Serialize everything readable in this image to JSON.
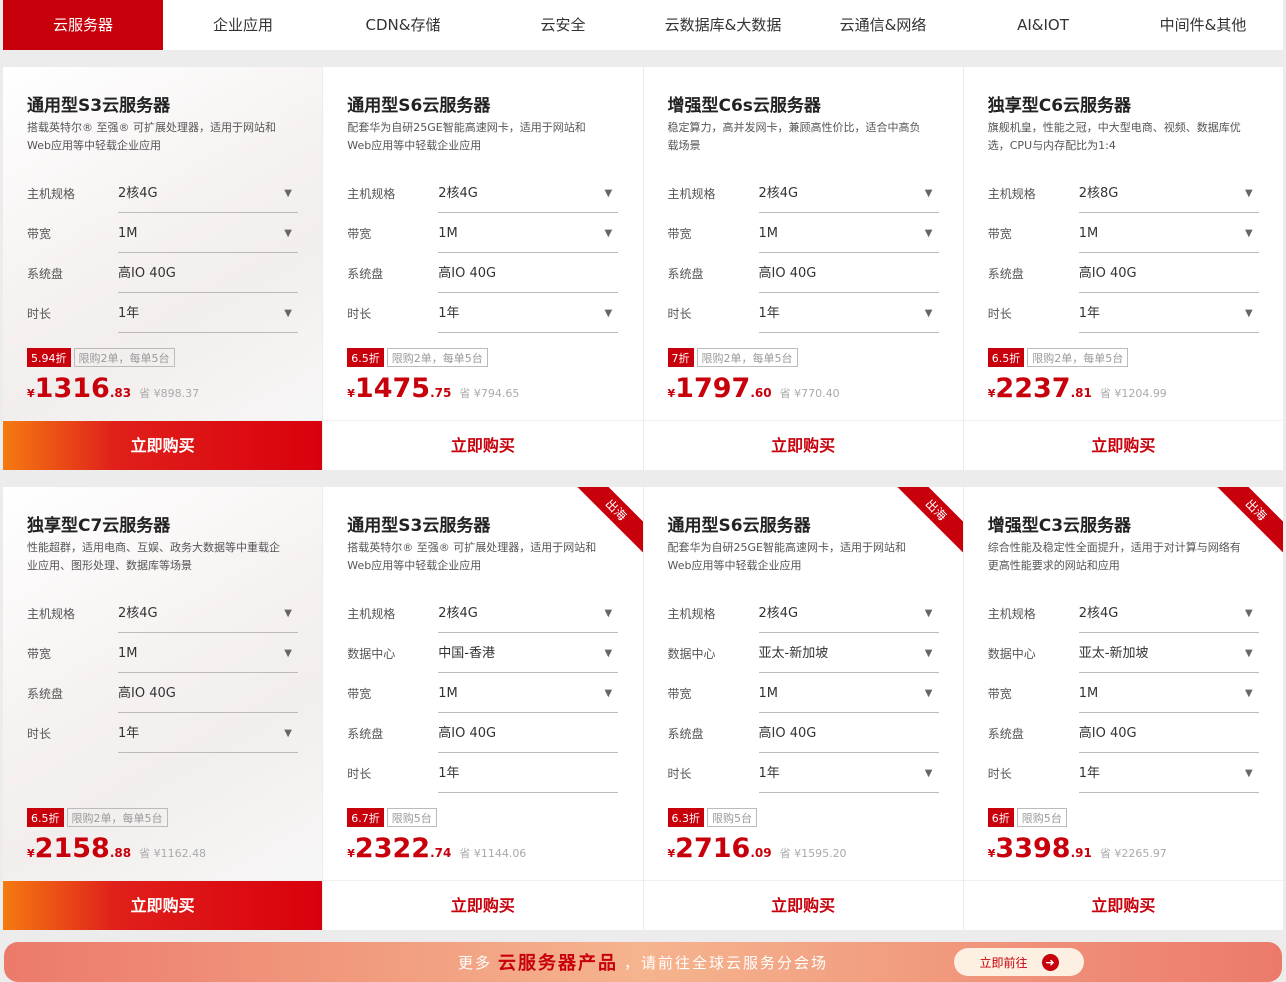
{
  "tabs": [
    "云服务器",
    "企业应用",
    "CDN&存储",
    "云安全",
    "云数据库&大数据",
    "云通信&网络",
    "AI&IOT",
    "中间件&其他"
  ],
  "buy_label": "立即购买",
  "ribbon_label": "出海",
  "rows": [
    [
      {
        "title": "通用型S3云服务器",
        "desc": "搭载英特尔® 至强® 可扩展处理器，适用于网站和Web应用等中轻载企业应用",
        "fields": [
          [
            "主机规格",
            "2核4G",
            1
          ],
          [
            "带宽",
            "1M",
            1
          ],
          [
            "系统盘",
            "高IO 40G",
            0
          ],
          [
            "时长",
            "1年",
            1
          ]
        ],
        "discount": "5.94折",
        "limit": "限购2单，每单5台",
        "price_int": "1316",
        "price_dec": ".83",
        "save": "省 ¥898.37",
        "ribbon": false
      },
      {
        "title": "通用型S6云服务器",
        "desc": "配套华为自研25GE智能高速网卡，适用于网站和Web应用等中轻载企业应用",
        "fields": [
          [
            "主机规格",
            "2核4G",
            1
          ],
          [
            "带宽",
            "1M",
            1
          ],
          [
            "系统盘",
            "高IO 40G",
            0
          ],
          [
            "时长",
            "1年",
            1
          ]
        ],
        "discount": "6.5折",
        "limit": "限购2单，每单5台",
        "price_int": "1475",
        "price_dec": ".75",
        "save": "省 ¥794.65",
        "ribbon": false
      },
      {
        "title": "增强型C6s云服务器",
        "desc": "稳定算力，高并发网卡，兼顾高性价比，适合中高负载场景",
        "fields": [
          [
            "主机规格",
            "2核4G",
            1
          ],
          [
            "带宽",
            "1M",
            1
          ],
          [
            "系统盘",
            "高IO 40G",
            0
          ],
          [
            "时长",
            "1年",
            1
          ]
        ],
        "discount": "7折",
        "limit": "限购2单，每单5台",
        "price_int": "1797",
        "price_dec": ".60",
        "save": "省 ¥770.40",
        "ribbon": false
      },
      {
        "title": "独享型C6云服务器",
        "desc": "旗舰机皇，性能之冠，中大型电商、视频、数据库优选，CPU与内存配比为1:4",
        "fields": [
          [
            "主机规格",
            "2核8G",
            1
          ],
          [
            "带宽",
            "1M",
            1
          ],
          [
            "系统盘",
            "高IO 40G",
            0
          ],
          [
            "时长",
            "1年",
            1
          ]
        ],
        "discount": "6.5折",
        "limit": "限购2单，每单5台",
        "price_int": "2237",
        "price_dec": ".81",
        "save": "省 ¥1204.99",
        "ribbon": false
      }
    ],
    [
      {
        "title": "独享型C7云服务器",
        "desc": "性能超群，适用电商、互娱、政务大数据等中重载企业应用、图形处理、数据库等场景",
        "fields": [
          [
            "主机规格",
            "2核4G",
            1
          ],
          [
            "带宽",
            "1M",
            1
          ],
          [
            "系统盘",
            "高IO 40G",
            0
          ],
          [
            "时长",
            "1年",
            1
          ]
        ],
        "discount": "6.5折",
        "limit": "限购2单，每单5台",
        "price_int": "2158",
        "price_dec": ".88",
        "save": "省 ¥1162.48",
        "ribbon": false
      },
      {
        "title": "通用型S3云服务器",
        "desc": "搭载英特尔® 至强® 可扩展处理器，适用于网站和Web应用等中轻载企业应用",
        "fields": [
          [
            "主机规格",
            "2核4G",
            1
          ],
          [
            "数据中心",
            "中国-香港",
            1
          ],
          [
            "带宽",
            "1M",
            1
          ],
          [
            "系统盘",
            "高IO 40G",
            0
          ],
          [
            "时长",
            "1年",
            0
          ]
        ],
        "discount": "6.7折",
        "limit": "限购5台",
        "price_int": "2322",
        "price_dec": ".74",
        "save": "省 ¥1144.06",
        "ribbon": true
      },
      {
        "title": "通用型S6云服务器",
        "desc": "配套华为自研25GE智能高速网卡，适用于网站和Web应用等中轻载企业应用",
        "fields": [
          [
            "主机规格",
            "2核4G",
            1
          ],
          [
            "数据中心",
            "亚太-新加坡",
            1
          ],
          [
            "带宽",
            "1M",
            1
          ],
          [
            "系统盘",
            "高IO 40G",
            0
          ],
          [
            "时长",
            "1年",
            1
          ]
        ],
        "discount": "6.3折",
        "limit": "限购5台",
        "price_int": "2716",
        "price_dec": ".09",
        "save": "省 ¥1595.20",
        "ribbon": true
      },
      {
        "title": "增强型C3云服务器",
        "desc": "综合性能及稳定性全面提升，适用于对计算与网络有更高性能要求的网站和应用",
        "fields": [
          [
            "主机规格",
            "2核4G",
            1
          ],
          [
            "数据中心",
            "亚太-新加坡",
            1
          ],
          [
            "带宽",
            "1M",
            1
          ],
          [
            "系统盘",
            "高IO 40G",
            0
          ],
          [
            "时长",
            "1年",
            1
          ]
        ],
        "discount": "6折",
        "limit": "限购5台",
        "price_int": "3398",
        "price_dec": ".91",
        "save": "省 ¥2265.97",
        "ribbon": true
      }
    ]
  ],
  "banner": {
    "pre": "更多",
    "highlight": "云服务器产品",
    "post": "，请前往全球云服务分会场",
    "button": "立即前往"
  }
}
